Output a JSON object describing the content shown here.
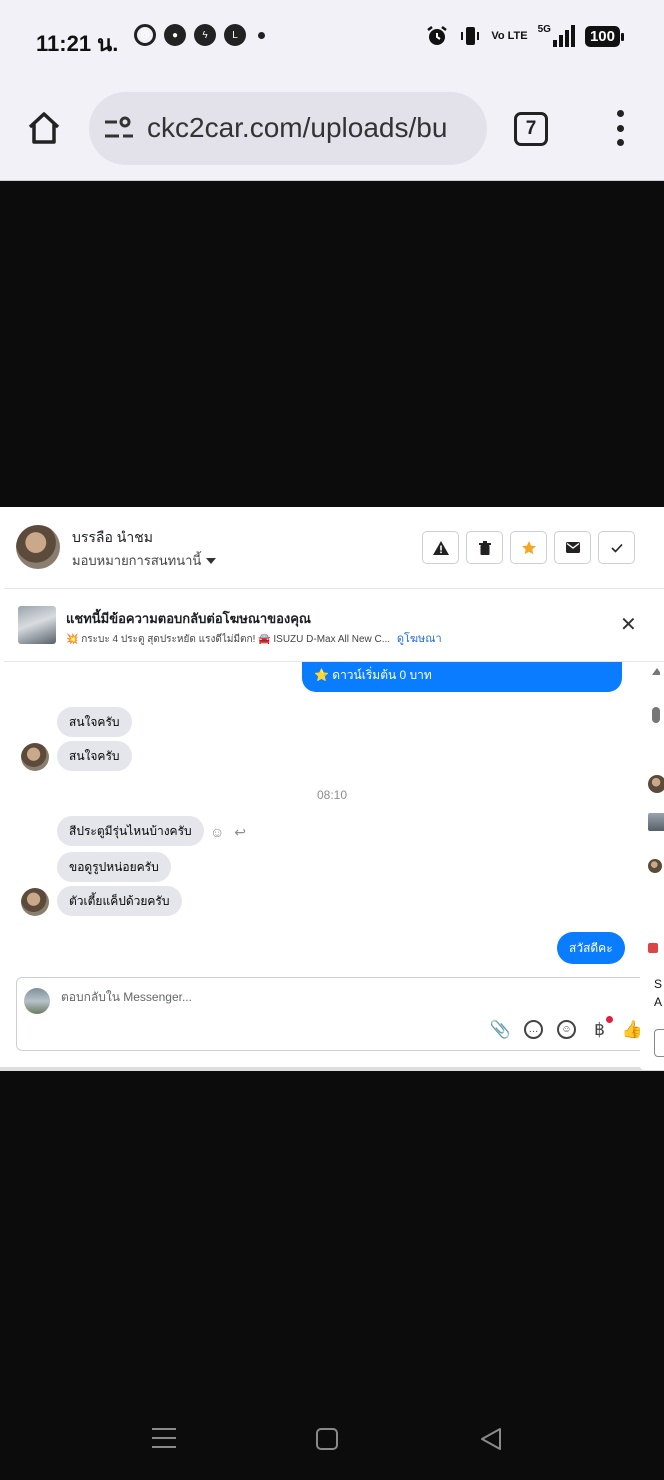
{
  "status_bar": {
    "time": "11:21 น.",
    "app_icons": [
      "threads-icon",
      "chat-bubble-icon",
      "messenger-icon",
      "line-icon"
    ],
    "volte": "Vo LTE",
    "network": "5G",
    "battery": "100"
  },
  "browser": {
    "url": "ckc2car.com/uploads/bu",
    "tab_count": "7"
  },
  "chat": {
    "user_name": "บรรลือ นำชม",
    "assign_label": "มอบหมายการสนทนานี้",
    "header_actions": [
      "warning-icon",
      "trash-icon",
      "star-icon",
      "mail-icon",
      "check-icon"
    ],
    "ad_notice": {
      "title": "แชทนี้มีข้อความตอบกลับต่อโฆษณาของคุณ",
      "subtitle": "💥 กระบะ 4 ประตู สุดประหยัด แรงดีไม่มีตก! 🚘 ISUZU D-Max All New C...",
      "link": "ดูโฆษณา"
    },
    "messages": {
      "out_top_line": "⭐ ดาวน์เริ่มต้น 0 บาท",
      "in_1": "สนใจครับ",
      "in_2": "สนใจครับ",
      "time_separator": "08:10",
      "in_3": "สีประตูมีรุ่นไหนบ้างครับ",
      "in_4": "ขอดูรูปหน่อยครับ",
      "in_5": "ตัวเตี้ยแค็ปด้วยครับ",
      "out_last": "สวัสดีคะ"
    },
    "composer": {
      "placeholder": "ตอบกลับใน Messenger..."
    }
  },
  "side_panel": {
    "text_1": "S",
    "text_2": "A"
  },
  "colors": {
    "accent_blue": "#0a7cff",
    "link_blue": "#216fdb",
    "bubble_gray": "#e4e6eb",
    "star_orange": "#f5a623"
  }
}
